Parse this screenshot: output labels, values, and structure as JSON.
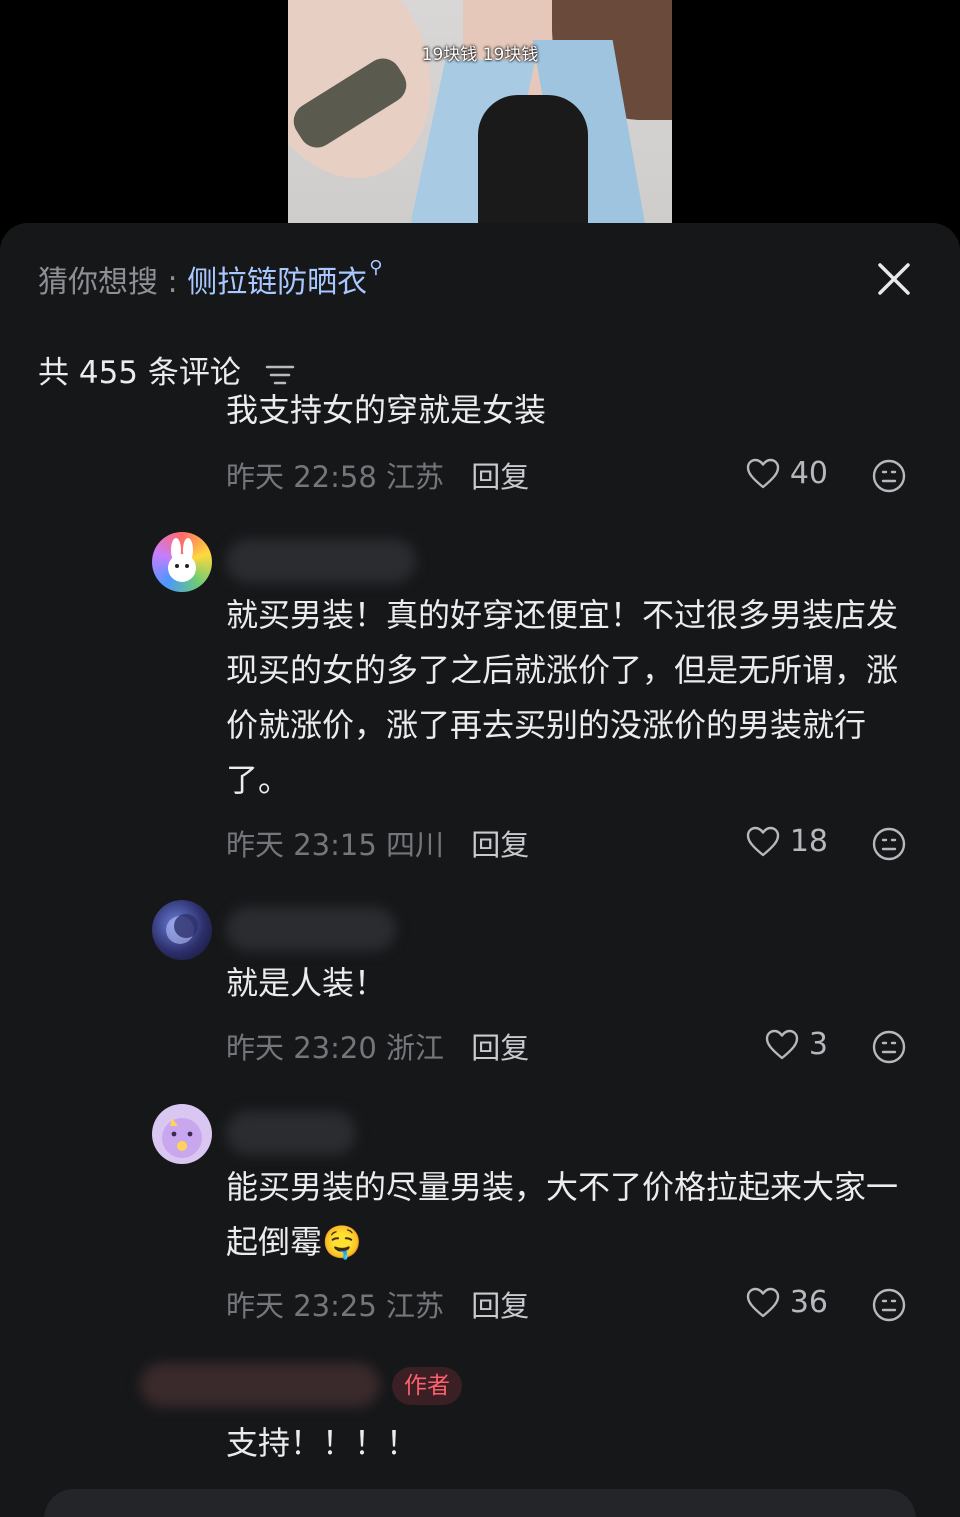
{
  "video": {
    "caption": "19块钱 19块钱"
  },
  "search_suggestion": {
    "label": "猜你想搜 : ",
    "term": "侧拉链防晒衣",
    "icon": "search-icon"
  },
  "header": {
    "comment_count": "共 455 条评论",
    "sort_icon": "sort-icon",
    "close_icon": "close-icon"
  },
  "comments": [
    {
      "text": "我支持女的穿就是女装",
      "date": "昨天",
      "time": "22:58",
      "location": "江苏",
      "reply": "回复",
      "likes": "40"
    },
    {
      "text": "就买男装！真的好穿还便宜！不过很多男装店发现买的女的多了之后就涨价了，但是无所谓，涨价就涨价，涨了再去买别的没涨价的男装就行了。",
      "date": "昨天",
      "time": "23:15",
      "location": "四川",
      "reply": "回复",
      "likes": "18"
    },
    {
      "text": "就是人装！",
      "date": "昨天",
      "time": "23:20",
      "location": "浙江",
      "reply": "回复",
      "likes": "3"
    },
    {
      "text": "能买男装的尽量男装，大不了价格拉起来大家一起倒霉",
      "emoji": "🤤",
      "date": "昨天",
      "time": "23:25",
      "location": "江苏",
      "reply": "回复",
      "likes": "36"
    },
    {
      "badge": "作者",
      "text": "支持！！！！"
    }
  ],
  "colors": {
    "sheet_bg": "#161719",
    "link_blue": "#a8c8ff",
    "author_red": "#ff5f6d"
  }
}
